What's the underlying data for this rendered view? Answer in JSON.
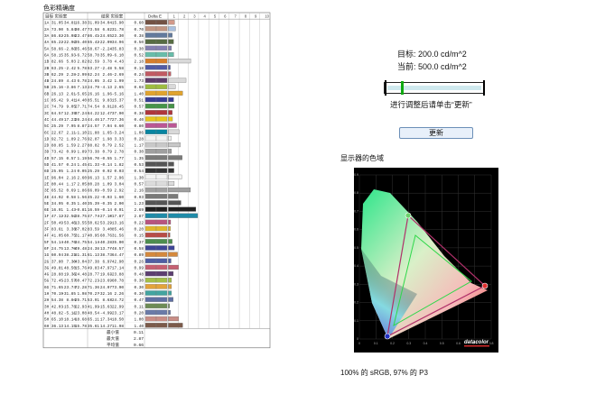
{
  "page_title": "色彩精确度",
  "table": {
    "headers": [
      "目标",
      "实验室",
      "结果",
      "实验室",
      "Delta E"
    ],
    "scale": [
      "1",
      "2",
      "3",
      "4",
      "5",
      "6",
      "7",
      "8",
      "9",
      "10"
    ],
    "rows": [
      [
        "1A",
        "31.05",
        "34.81",
        "16.38",
        "31.09",
        "34.04",
        "15.90",
        "0.60"
      ],
      [
        "2A",
        "73.90",
        "5.84",
        "30.47",
        "73.58",
        "6.82",
        "31.78",
        "0.70"
      ],
      [
        "3A",
        "86.82",
        "-25.08",
        "23.47",
        "86.41",
        "-24.65",
        "23.30",
        "0.38"
      ],
      [
        "4A",
        "65.22",
        "-22.92",
        "-35.40",
        "65.42",
        "-22.09",
        "-34.96",
        "0.50"
      ],
      [
        "5A",
        "58.66",
        "-2.03",
        "-35.46",
        "58.67",
        "-2.24",
        "-35.83",
        "0.30"
      ],
      [
        "6A",
        "58.15",
        "35.93",
        "-6.72",
        "58.78",
        "35.09",
        "-6.10",
        "0.52"
      ],
      [
        "1B",
        "82.66",
        "5.03",
        "2.82",
        "82.59",
        "3.78",
        "4.43",
        "2.18"
      ],
      [
        "2B",
        "63.25",
        "-2.42",
        "5.78",
        "63.27",
        "-2.48",
        "5.58",
        "0.18"
      ],
      [
        "3B",
        "62.29",
        "2.28",
        "-2.99",
        "62.24",
        "2.46",
        "-2.69",
        "0.24"
      ],
      [
        "4B",
        "24.89",
        "4.43",
        "6.78",
        "24.05",
        "3.42",
        "1.99",
        "1.73"
      ],
      [
        "5B",
        "25.16",
        "-3.86",
        "7.13",
        "24.79",
        "-4.13",
        "2.65",
        "0.68"
      ],
      [
        "6B",
        "26.13",
        "2.61",
        "-5.65",
        "26.16",
        "1.96",
        "-5.16",
        "1.40"
      ],
      [
        "1C",
        "85.42",
        "9.41",
        "14.40",
        "85.51",
        "9.83",
        "15.37",
        "0.51"
      ],
      [
        "2C",
        "74.79",
        "9.05",
        "27.71",
        "74.54",
        "8.91",
        "28.45",
        "0.57"
      ],
      [
        "3C",
        "64.57",
        "12.39",
        "37.24",
        "64.22",
        "12.47",
        "37.90",
        "0.38"
      ],
      [
        "4C",
        "44.49",
        "17.23",
        "26.24",
        "44.46",
        "17.77",
        "27.36",
        "0.40"
      ],
      [
        "5C",
        "25.29",
        "7.95",
        "8.87",
        "24.57",
        "7.04",
        "6.60",
        "0.80"
      ],
      [
        "6C",
        "22.67",
        "2.11",
        "-1.10",
        "21.88",
        "1.65",
        "-3.24",
        "1.06"
      ],
      [
        "1D",
        "92.72",
        "1.89",
        "2.76",
        "92.87",
        "1.98",
        "3.33",
        "0.28"
      ],
      [
        "2D",
        "88.85",
        "1.59",
        "2.27",
        "88.82",
        "0.79",
        "2.52",
        "1.17"
      ],
      [
        "3D",
        "73.42",
        "0.99",
        "1.89",
        "73.38",
        "0.79",
        "2.78",
        "0.30"
      ],
      [
        "4D",
        "57.15",
        "0.57",
        "1.19",
        "56.70",
        "-0.55",
        "1.77",
        "1.35"
      ],
      [
        "5D",
        "41.57",
        "0.24",
        "1.45",
        "41.33",
        "-0.14",
        "1.82",
        "0.53"
      ],
      [
        "6D",
        "25.95",
        "1.24",
        "0.05",
        "25.29",
        "0.92",
        "0.03",
        "0.54"
      ],
      [
        "1E",
        "96.04",
        "2.16",
        "2.60",
        "96.13",
        "1.57",
        "2.96",
        "1.30"
      ],
      [
        "2E",
        "80.44",
        "1.17",
        "2.05",
        "80.28",
        "1.09",
        "3.04",
        "0.57"
      ],
      [
        "3E",
        "65.52",
        "0.69",
        "1.86",
        "66.09",
        "-0.59",
        "2.92",
        "2.16"
      ],
      [
        "4E",
        "44.92",
        "0.58",
        "1.56",
        "45.22",
        "-0.03",
        "1.60",
        "0.93"
      ],
      [
        "5E",
        "34.95",
        "0.35",
        "1.40",
        "35.39",
        "-0.35",
        "2.00",
        "1.23"
      ],
      [
        "6E",
        "16.91",
        "1.43",
        "-0.81",
        "16.59",
        "-0.14",
        "0.91",
        "2.69"
      ],
      [
        "1F",
        "47.12",
        "-32.52",
        "-28.75",
        "47.74",
        "-27.10",
        "-17.87",
        "2.87"
      ],
      [
        "2F",
        "50.49",
        "53.45",
        "-13.55",
        "50.62",
        "53.29",
        "-13.16",
        "0.22"
      ],
      [
        "3F",
        "83.61",
        "3.36",
        "87.02",
        "83.59",
        "3.40",
        "85.46",
        "0.20"
      ],
      [
        "4F",
        "41.05",
        "60.75",
        "31.17",
        "40.95",
        "60.76",
        "31.56",
        "0.15"
      ],
      [
        "5F",
        "54.14",
        "-40.76",
        "34.75",
        "54.14",
        "-40.28",
        "35.00",
        "0.37"
      ],
      [
        "6F",
        "24.75",
        "13.78",
        "-49.48",
        "24.38",
        "13.77",
        "-48.57",
        "0.58"
      ],
      [
        "1G",
        "60.94",
        "38.21",
        "61.31",
        "61.13",
        "38.73",
        "64.47",
        "0.89"
      ],
      [
        "2G",
        "37.80",
        "7.30",
        "-43.04",
        "37.38",
        "6.97",
        "-42.90",
        "0.26"
      ],
      [
        "3G",
        "49.81",
        "48.50",
        "15.76",
        "49.83",
        "47.97",
        "17.14",
        "0.99"
      ],
      [
        "4G",
        "28.88",
        "19.36",
        "-24.48",
        "28.77",
        "19.63",
        "-23.88",
        "0.48"
      ],
      [
        "5G",
        "72.45",
        "-23.57",
        "60.47",
        "72.23",
        "-23.69",
        "60.78",
        "0.30"
      ],
      [
        "6G",
        "71.65",
        "23.74",
        "72.28",
        "71.36",
        "24.07",
        "73.90",
        "0.30"
      ],
      [
        "1H",
        "70.19",
        "-31.85",
        "1.98",
        "70.27",
        "-32.16",
        "2.26",
        "0.30"
      ],
      [
        "2H",
        "54.38",
        "8.84",
        "-25.71",
        "53.91",
        "8.63",
        "-24.72",
        "0.47"
      ],
      [
        "3H",
        "42.03",
        "-15.78",
        "22.93",
        "41.99",
        "-15.63",
        "22.99",
        "0.11"
      ],
      [
        "4H",
        "48.82",
        "-5.11",
        "-23.08",
        "48.54",
        "-4.99",
        "-23.17",
        "0.20"
      ],
      [
        "5H",
        "65.10",
        "18.14",
        "18.68",
        "65.11",
        "17.34",
        "18.50",
        "1.00"
      ],
      [
        "6H",
        "36.13",
        "14.15",
        "15.78",
        "35.61",
        "14.27",
        "11.98",
        "1.40"
      ]
    ],
    "summary": [
      {
        "label": "最小值",
        "value": "0.11"
      },
      {
        "label": "最大值",
        "value": "2.87"
      },
      {
        "label": "平均值",
        "value": "0.66"
      }
    ],
    "bar_colors": [
      "#735244",
      "#c29682",
      "#627a9d",
      "#576c43",
      "#8580b1",
      "#67bdaa",
      "#d67e2c",
      "#505ba6",
      "#c15a63",
      "#5e3c6c",
      "#9dbc40",
      "#e0a32e",
      "#383d96",
      "#469449",
      "#af363c",
      "#e7c71f",
      "#bb5695",
      "#0885a1",
      "#f3f3f2",
      "#c8c8c8",
      "#a0a0a0",
      "#7a7a79",
      "#555555",
      "#343434",
      "#f3f3f2",
      "#dcdcdc",
      "#a0a0a0",
      "#7a7a79",
      "#555555",
      "#202020",
      "#1f8ba8",
      "#b8547f",
      "#e0b82e",
      "#b84c46",
      "#4d8d4e",
      "#3f4596",
      "#d4883c",
      "#4f5ea4",
      "#c66072",
      "#5c3f71",
      "#a3bf49",
      "#e3a33a",
      "#42a4a0",
      "#5f6fa3",
      "#6e8c55",
      "#6a7ba8",
      "#c98e86",
      "#7b5a4a"
    ],
    "fill_colors": [
      "#d39a8a",
      "#a9c0e0",
      "#ffffff",
      "#ffffff",
      "#ffffff",
      "#ffffff",
      "#d9d9d9",
      "#ffffff",
      "#ffffff",
      "#d9d9d9",
      "#d9d9d9",
      "#ffffff",
      "#ffffff",
      "#ffffff",
      "#ffffff",
      "#ffffff",
      "#ffffff",
      "#d9d9d9",
      "#ffffff",
      "#ffffff",
      "#ffffff",
      "#ffffff",
      "#ffffff",
      "#ffffff",
      "#ffffff",
      "#ffffff",
      "#ffffff",
      "#ffffff",
      "#ffffff",
      "#ffffff",
      "#ffffff",
      "#ffffff",
      "#ffffff",
      "#ffffff",
      "#ffffff",
      "#ffffff",
      "#ffffff",
      "#ffffff",
      "#ffffff",
      "#ffffff",
      "#ffffff",
      "#ffffff",
      "#ffffff",
      "#ffffff",
      "#ffffff",
      "#ffffff",
      "#ffffff",
      "#ffffff"
    ]
  },
  "luminance": {
    "target_label": "目标:",
    "target_value": "200.0 cd/m^2",
    "current_label": "当前:",
    "current_value": "500.0 cd/m^2",
    "slider_level": 0.12,
    "hint": "进行调整后请单击“更新”",
    "update_button": "更新"
  },
  "gamut": {
    "title": "显示器的色域",
    "brand": "datacolor",
    "axis_ticks_x": [
      "0",
      "0.1",
      "0.2",
      "0.3",
      "0.4",
      "0.5",
      "0.6",
      "0.7",
      "0.8"
    ],
    "axis_ticks_y": [
      "0",
      "0.1",
      "0.2",
      "0.3",
      "0.4",
      "0.5",
      "0.6",
      "0.7",
      "0.8",
      "0.9"
    ],
    "footer": "100% 的 sRGB, 97% 的 P3"
  }
}
